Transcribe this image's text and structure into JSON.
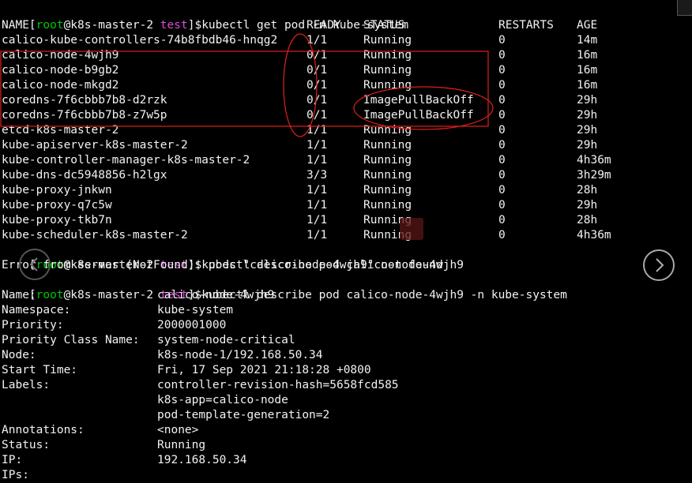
{
  "prompt1": {
    "open": "[",
    "user": "root",
    "host": "@k8s-master-2 ",
    "dir": "test",
    "close": "]$",
    "cmd": "kubectl get pod -n kube-system"
  },
  "table_header": {
    "name": "NAME",
    "ready": "READY",
    "status": "STATUS",
    "restarts": "RESTARTS",
    "age": "AGE"
  },
  "pods": [
    {
      "name": "calico-kube-controllers-74b8fbdb46-hnqg2",
      "ready": "1/1",
      "status": "Running",
      "restarts": "0",
      "age": "14m"
    },
    {
      "name": "calico-node-4wjh9",
      "ready": "0/1",
      "status": "Running",
      "restarts": "0",
      "age": "16m"
    },
    {
      "name": "calico-node-b9gb2",
      "ready": "0/1",
      "status": "Running",
      "restarts": "0",
      "age": "16m"
    },
    {
      "name": "calico-node-mkgd2",
      "ready": "0/1",
      "status": "Running",
      "restarts": "0",
      "age": "16m"
    },
    {
      "name": "coredns-7f6cbbb7b8-d2rzk",
      "ready": "0/1",
      "status": "ImagePullBackOff",
      "restarts": "0",
      "age": "29h"
    },
    {
      "name": "coredns-7f6cbbb7b8-z7w5p",
      "ready": "0/1",
      "status": "ImagePullBackOff",
      "restarts": "0",
      "age": "29h"
    },
    {
      "name": "etcd-k8s-master-2",
      "ready": "1/1",
      "status": "Running",
      "restarts": "0",
      "age": "29h"
    },
    {
      "name": "kube-apiserver-k8s-master-2",
      "ready": "1/1",
      "status": "Running",
      "restarts": "0",
      "age": "29h"
    },
    {
      "name": "kube-controller-manager-k8s-master-2",
      "ready": "1/1",
      "status": "Running",
      "restarts": "0",
      "age": "4h36m"
    },
    {
      "name": "kube-dns-dc5948856-h2lgx",
      "ready": "3/3",
      "status": "Running",
      "restarts": "0",
      "age": "3h29m"
    },
    {
      "name": "kube-proxy-jnkwn",
      "ready": "1/1",
      "status": "Running",
      "restarts": "0",
      "age": "28h"
    },
    {
      "name": "kube-proxy-q7c5w",
      "ready": "1/1",
      "status": "Running",
      "restarts": "0",
      "age": "29h"
    },
    {
      "name": "kube-proxy-tkb7n",
      "ready": "1/1",
      "status": "Running",
      "restarts": "0",
      "age": "28h"
    },
    {
      "name": "kube-scheduler-k8s-master-2",
      "ready": "1/1",
      "status": "Running",
      "restarts": "0",
      "age": "4h36m"
    }
  ],
  "prompt2": {
    "open": "[",
    "user": "root",
    "host": "@k8s-master-2 ",
    "dir": "test",
    "close": "]$",
    "cmd": "kubectl describe pod calico-node-4wjh9"
  },
  "error_line": "Error from server (NotFound): pods \"calico-node-4wjh9\" not found",
  "prompt3": {
    "open": "[",
    "user": "root",
    "host": "@k8s-master-2 ",
    "dir": "test",
    "close": "]$",
    "cmd": "kubectl describe pod calico-node-4wjh9 -n kube-system"
  },
  "describe": [
    {
      "key": "Name:",
      "value": "calico-node-4wjh9"
    },
    {
      "key": "Namespace:",
      "value": "kube-system"
    },
    {
      "key": "Priority:",
      "value": "2000001000"
    },
    {
      "key": "Priority Class Name:",
      "value": "system-node-critical"
    },
    {
      "key": "Node:",
      "value": "k8s-node-1/192.168.50.34"
    },
    {
      "key": "Start Time:",
      "value": "Fri, 17 Sep 2021 21:18:28 +0800"
    },
    {
      "key": "Labels:",
      "value": "controller-revision-hash=5658fcd585"
    },
    {
      "key": "",
      "value": "k8s-app=calico-node"
    },
    {
      "key": "",
      "value": "pod-template-generation=2"
    },
    {
      "key": "Annotations:",
      "value": "<none>"
    },
    {
      "key": "Status:",
      "value": "Running"
    },
    {
      "key": "IP:",
      "value": "192.168.50.34"
    },
    {
      "key": "IPs:",
      "value": ""
    }
  ],
  "colors": {
    "prompt_user": "#00c800",
    "prompt_dir": "#d94dd9",
    "annotation": "#e0201c",
    "text": "#f2f2f2",
    "background": "#000000"
  },
  "icons": {
    "prev": "chevron-left-icon",
    "next": "chevron-right-icon"
  }
}
